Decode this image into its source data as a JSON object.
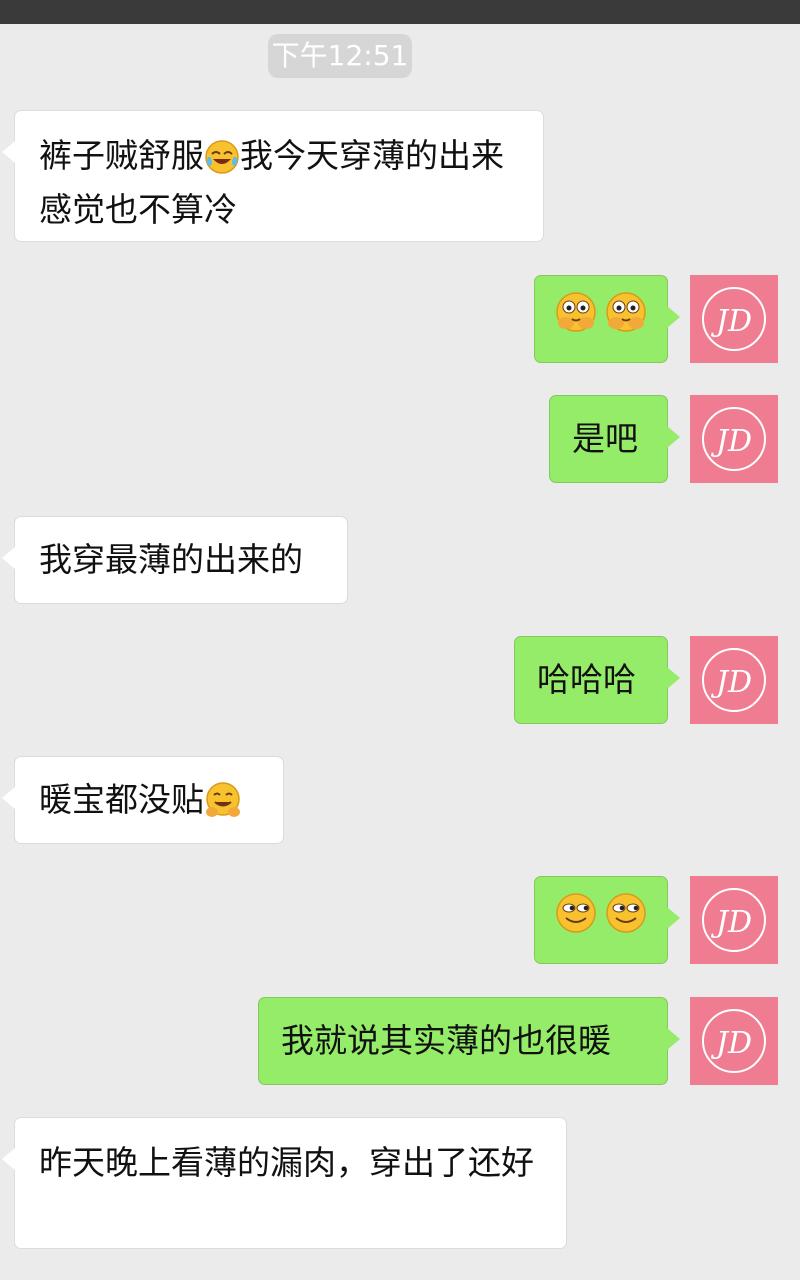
{
  "timestamp": "下午12:51",
  "colors": {
    "sent_bubble": "#95ec69",
    "received_bubble": "#ffffff",
    "background": "#ebebeb",
    "avatar_bg": "#f07c92"
  },
  "messages": [
    {
      "side": "left",
      "text_before_emoji": "裤子贼舒服",
      "emoji": "tears-of-joy-emoji",
      "text_after_emoji": "我今天穿薄的出来感觉也不算冷"
    },
    {
      "side": "right",
      "emojis": [
        "face-palm-peek-emoji",
        "face-palm-peek-emoji"
      ]
    },
    {
      "side": "right",
      "text": "是吧"
    },
    {
      "side": "left",
      "text": "我穿最薄的出来的"
    },
    {
      "side": "right",
      "text": "哈哈哈"
    },
    {
      "side": "left",
      "text_before_emoji": "暖宝都没贴",
      "emoji": "smirk-hands-emoji"
    },
    {
      "side": "right",
      "emojis": [
        "sly-smile-emoji",
        "sly-smile-emoji"
      ]
    },
    {
      "side": "right",
      "text": "我就说其实薄的也很暖"
    },
    {
      "side": "left",
      "text": "昨天晚上看薄的漏肉，穿出了还好"
    }
  ],
  "avatar": {
    "icon": "jd-logo-avatar"
  }
}
